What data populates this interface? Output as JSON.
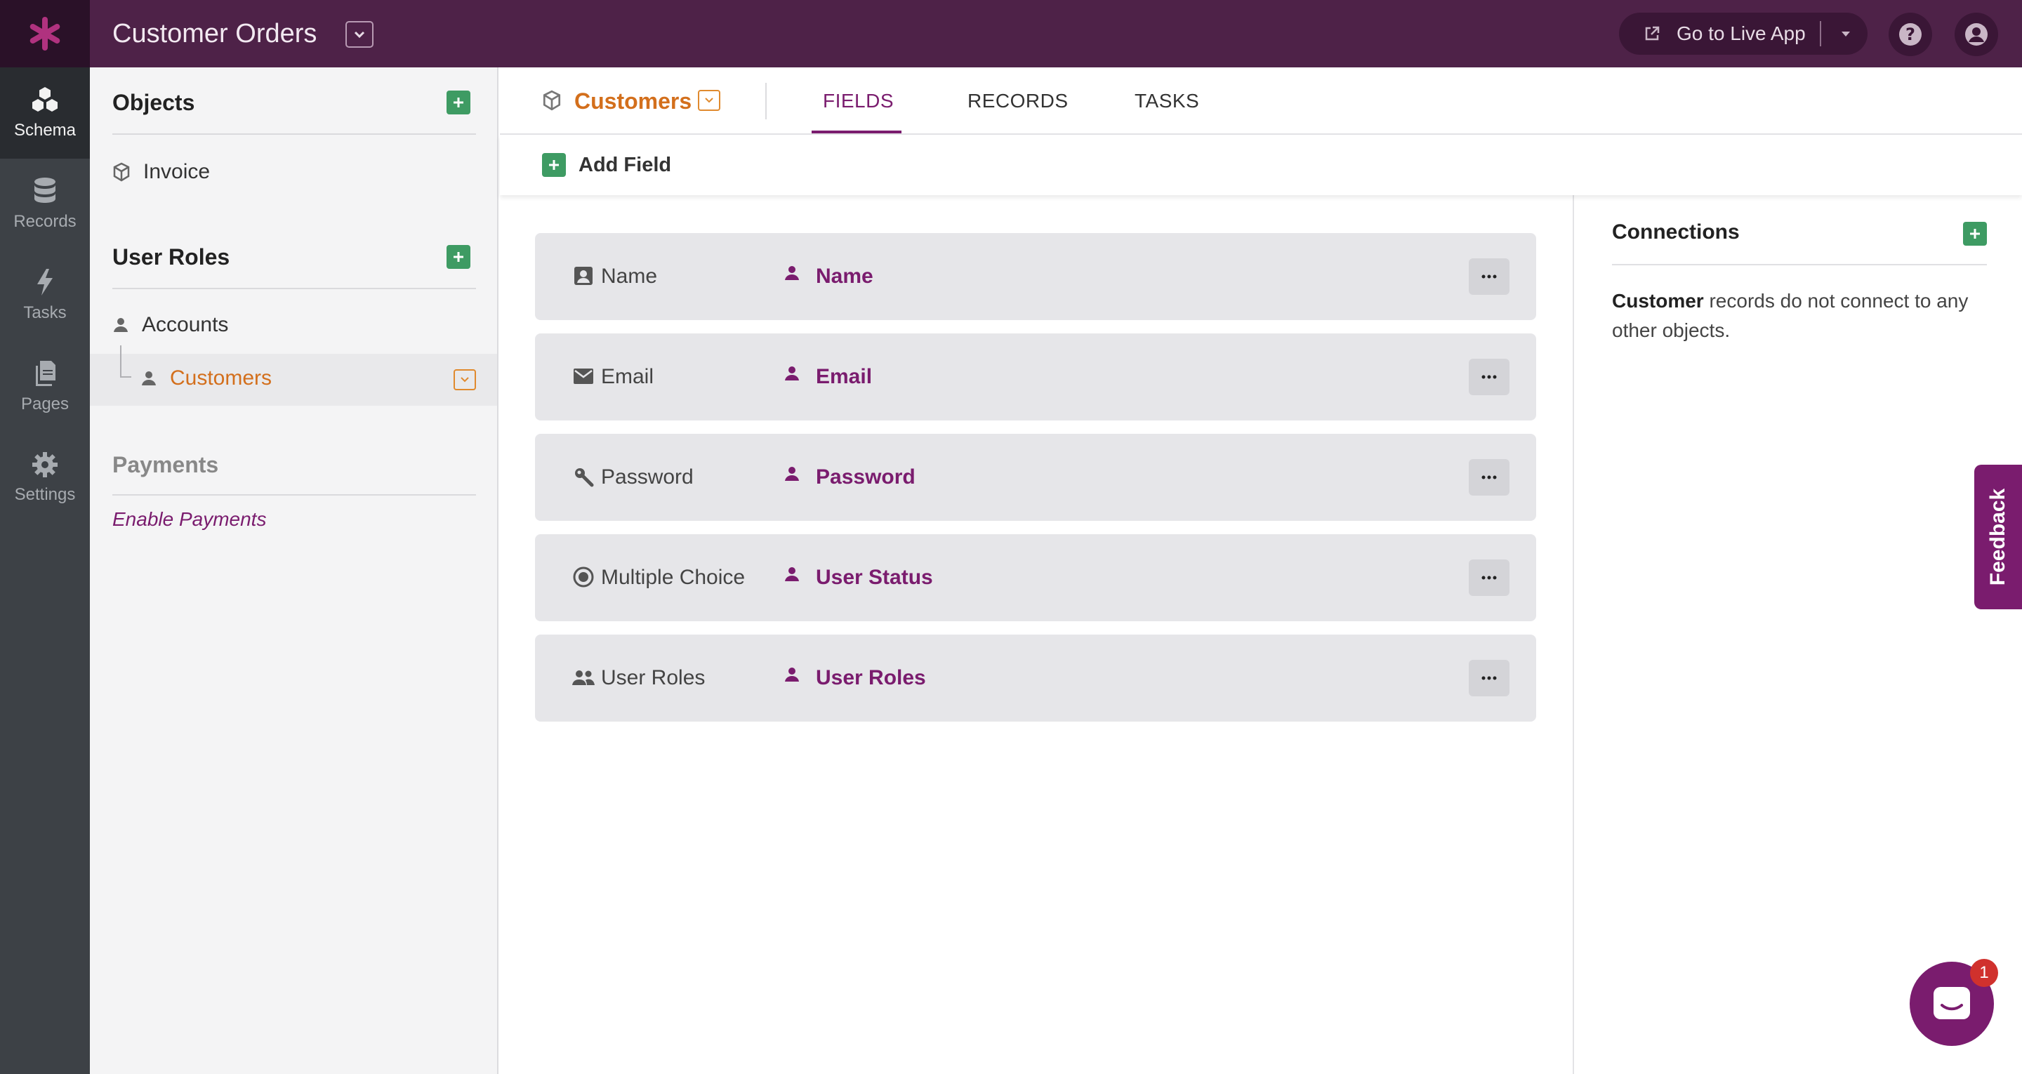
{
  "app": {
    "title": "Customer Orders",
    "live_app_label": "Go to Live App"
  },
  "rail": [
    {
      "label": "Schema",
      "icon": "schema-icon",
      "active": true
    },
    {
      "label": "Records",
      "icon": "database-icon"
    },
    {
      "label": "Tasks",
      "icon": "bolt-icon"
    },
    {
      "label": "Pages",
      "icon": "pages-icon"
    },
    {
      "label": "Settings",
      "icon": "gear-icon"
    }
  ],
  "sidebar": {
    "objects_heading": "Objects",
    "objects": [
      "Invoice"
    ],
    "roles_heading": "User Roles",
    "roles": [
      "Accounts",
      "Customers"
    ],
    "payments_heading": "Payments",
    "payments_link": "Enable Payments"
  },
  "object": {
    "name": "Customers",
    "tabs": [
      "FIELDS",
      "RECORDS",
      "TASKS"
    ],
    "active_tab": "FIELDS",
    "add_field_label": "Add Field"
  },
  "fields": [
    {
      "type": "Name",
      "type_icon": "contact-card-icon",
      "name": "Name"
    },
    {
      "type": "Email",
      "type_icon": "envelope-icon",
      "name": "Email"
    },
    {
      "type": "Password",
      "type_icon": "key-icon",
      "name": "Password"
    },
    {
      "type": "Multiple Choice",
      "type_icon": "radio-icon",
      "name": "User Status"
    },
    {
      "type": "User Roles",
      "type_icon": "group-icon",
      "name": "User Roles"
    }
  ],
  "connections": {
    "heading": "Connections",
    "subject": "Customer",
    "text": " records do not connect to any other objects."
  },
  "feedback_label": "Feedback",
  "chat_badge": "1",
  "colors": {
    "topbar": "#4e2248",
    "accent": "#7a1c6e",
    "orange": "#d36f1c",
    "green": "#3e9b63"
  }
}
